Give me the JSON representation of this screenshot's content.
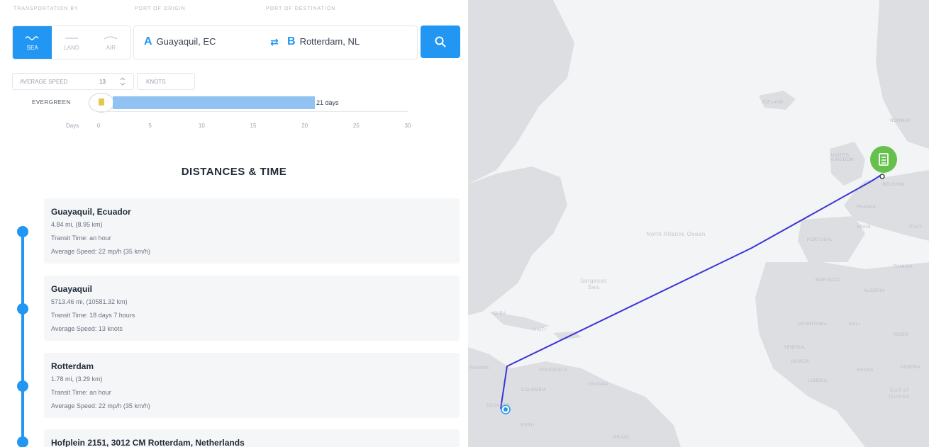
{
  "labels": {
    "transport": "TRANSPORTATION BY",
    "origin": "PORT OF ORIGIN",
    "destination": "PORT OF DESTINATION"
  },
  "modes": [
    {
      "label": "SEA",
      "active": true,
      "icon": "waves-icon"
    },
    {
      "label": "LAND",
      "active": false,
      "icon": "road-icon"
    },
    {
      "label": "AIR",
      "active": false,
      "icon": "plane-icon"
    }
  ],
  "route": {
    "a_letter": "A",
    "origin": "Guayaquil, EC",
    "swap": "⇄",
    "b_letter": "B",
    "destination": "Rotterdam, NL"
  },
  "speed": {
    "label": "AVERAGE SPEED",
    "value": "13",
    "unit": "KNOTS"
  },
  "chart_data": {
    "type": "bar",
    "categories": [
      "EVERGREEN"
    ],
    "values": [
      21
    ],
    "value_labels": [
      "21 days"
    ],
    "xlabel": "Days",
    "ticks": [
      "0",
      "5",
      "10",
      "15",
      "20",
      "25",
      "30"
    ],
    "xlim": [
      0,
      30
    ],
    "bar_color": "#90c2f3"
  },
  "heading": "DISTANCES & TIME",
  "legs": [
    {
      "title": "Guayaquil, Ecuador",
      "distance": "4.84 mi, (8.95 km)",
      "transit": "Transit Time: an hour",
      "speed": "Average Speed: 22 mp/h (35 km/h)"
    },
    {
      "title": "Guayaquil",
      "distance": "5713.46 mi, (10581.32 km)",
      "transit": "Transit Time: 18 days 7 hours",
      "speed": "Average Speed: 13 knots"
    },
    {
      "title": "Rotterdam",
      "distance": "1.78 mi, (3.29 km)",
      "transit": "Transit Time: an hour",
      "speed": "Average Speed: 22 mp/h (35 km/h)"
    },
    {
      "title": "Hofplein 2151, 3012 CM Rotterdam, Netherlands"
    }
  ],
  "map": {
    "labels": {
      "greenland": "Greenland",
      "iceland": "ICELAND",
      "norway": "NORWAY",
      "uk": "UNITED KINGDOM",
      "belgium": "BELGIUM",
      "france": "FRANCE",
      "spain": "SPAIN",
      "portugal": "PORTUGAL",
      "italy": "ITALY",
      "tunisia": "TUNISIA",
      "morocco": "MOROCCO",
      "algeria": "ALGERIA",
      "north_atlantic": "North Atlantic Ocean",
      "sargasso": "Sargasso Sea",
      "cuba": "CUBA",
      "haiti": "HAITI",
      "panama": "PANAMA",
      "venezuela": "VENEZUELA",
      "guyana": "GUYANA",
      "colombia": "COLOMBIA",
      "ecuador": "ECUADOR",
      "peru": "PERU",
      "brazil": "BRAZIL",
      "mauritania": "MAURITANIA",
      "mali": "MALI",
      "niger": "NIGER",
      "senegal": "SENEGAL",
      "guinea": "GUINEA",
      "liberia": "LIBERIA",
      "nigeria": "NIGERIA",
      "gulf_guinea": "Gulf of Guinea",
      "ghana": "GHANA"
    },
    "route_color": "#3b35d6",
    "land_color": "#dcdee2",
    "sea_color": "#f3f4f6",
    "pin_color": "#65c14c"
  }
}
